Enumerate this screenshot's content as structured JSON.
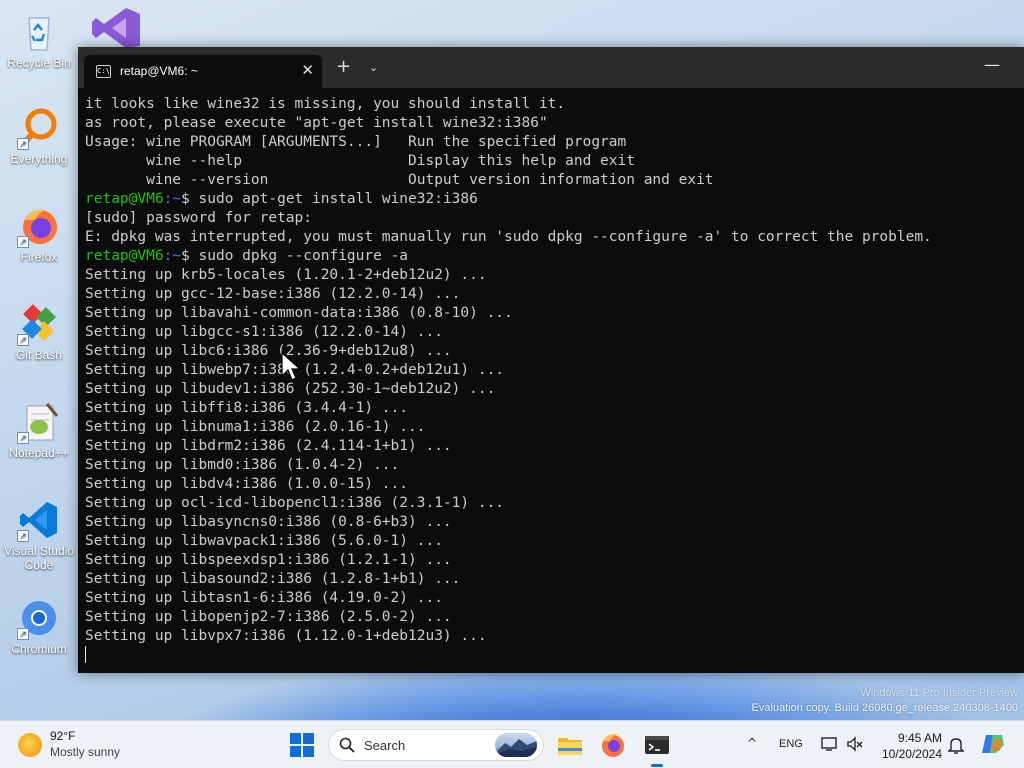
{
  "desktop": {
    "icons": [
      {
        "label": "Recycle Bin"
      },
      {
        "label": "Everything"
      },
      {
        "label": "Firefox"
      },
      {
        "label": "Git Bash"
      },
      {
        "label": "Notepad++"
      },
      {
        "label": "Visual Studio Code"
      },
      {
        "label": "Chromium"
      }
    ],
    "watermark": {
      "line1": "Windows 11 Pro Insider Preview",
      "line2": "Evaluation copy. Build 26080.ge_release.240308-1400"
    }
  },
  "terminal": {
    "tab_title": "retap@VM6: ~",
    "tab_icon_text": "C:\\",
    "close_glyph": "✕",
    "new_tab_glyph": "+",
    "dropdown_glyph": "⌄",
    "minimize_glyph": "—",
    "prompt": {
      "user": "retap@VM6",
      "path": ":~",
      "symbol": "$ "
    },
    "lines": [
      {
        "type": "text",
        "text": "it looks like wine32 is missing, you should install it."
      },
      {
        "type": "text",
        "text": "as root, please execute \"apt-get install wine32:i386\""
      },
      {
        "type": "text",
        "text": "Usage: wine PROGRAM [ARGUMENTS...]   Run the specified program"
      },
      {
        "type": "text",
        "text": "       wine --help                   Display this help and exit"
      },
      {
        "type": "text",
        "text": "       wine --version                Output version information and exit"
      },
      {
        "type": "prompt",
        "text": "sudo apt-get install wine32:i386"
      },
      {
        "type": "text",
        "text": "[sudo] password for retap:"
      },
      {
        "type": "text",
        "text": "E: dpkg was interrupted, you must manually run 'sudo dpkg --configure -a' to correct the problem."
      },
      {
        "type": "prompt",
        "text": "sudo dpkg --configure -a"
      },
      {
        "type": "text",
        "text": "Setting up krb5-locales (1.20.1-2+deb12u2) ..."
      },
      {
        "type": "text",
        "text": "Setting up gcc-12-base:i386 (12.2.0-14) ..."
      },
      {
        "type": "text",
        "text": "Setting up libavahi-common-data:i386 (0.8-10) ..."
      },
      {
        "type": "text",
        "text": "Setting up libgcc-s1:i386 (12.2.0-14) ..."
      },
      {
        "type": "text",
        "text": "Setting up libc6:i386 (2.36-9+deb12u8) ..."
      },
      {
        "type": "text",
        "text": "Setting up libwebp7:i386 (1.2.4-0.2+deb12u1) ..."
      },
      {
        "type": "text",
        "text": "Setting up libudev1:i386 (252.30-1~deb12u2) ..."
      },
      {
        "type": "text",
        "text": "Setting up libffi8:i386 (3.4.4-1) ..."
      },
      {
        "type": "text",
        "text": "Setting up libnuma1:i386 (2.0.16-1) ..."
      },
      {
        "type": "text",
        "text": "Setting up libdrm2:i386 (2.4.114-1+b1) ..."
      },
      {
        "type": "text",
        "text": "Setting up libmd0:i386 (1.0.4-2) ..."
      },
      {
        "type": "text",
        "text": "Setting up libdv4:i386 (1.0.0-15) ..."
      },
      {
        "type": "text",
        "text": "Setting up ocl-icd-libopencl1:i386 (2.3.1-1) ..."
      },
      {
        "type": "text",
        "text": "Setting up libasyncns0:i386 (0.8-6+b3) ..."
      },
      {
        "type": "text",
        "text": "Setting up libwavpack1:i386 (5.6.0-1) ..."
      },
      {
        "type": "text",
        "text": "Setting up libspeexdsp1:i386 (1.2.1-1) ..."
      },
      {
        "type": "text",
        "text": "Setting up libasound2:i386 (1.2.8-1+b1) ..."
      },
      {
        "type": "text",
        "text": "Setting up libtasn1-6:i386 (4.19.0-2) ..."
      },
      {
        "type": "text",
        "text": "Setting up libopenjp2-7:i386 (2.5.0-2) ..."
      },
      {
        "type": "text",
        "text": "Setting up libvpx7:i386 (1.12.0-1+deb12u3) ..."
      },
      {
        "type": "cursor",
        "text": ""
      }
    ],
    "colors": {
      "background": "#0c0c0c",
      "text": "#cccccc",
      "prompt_user": "#16c60c",
      "prompt_path": "#3b78ff"
    }
  },
  "taskbar": {
    "weather": {
      "temp": "92°F",
      "desc": "Mostly sunny"
    },
    "search_placeholder": "Search",
    "apps": [
      "file-explorer-icon",
      "firefox-icon",
      "terminal-icon"
    ],
    "tray": {
      "chevron": "^",
      "language": "ENG"
    },
    "clock": {
      "time": "9:45 AM",
      "date": "10/20/2024"
    }
  }
}
